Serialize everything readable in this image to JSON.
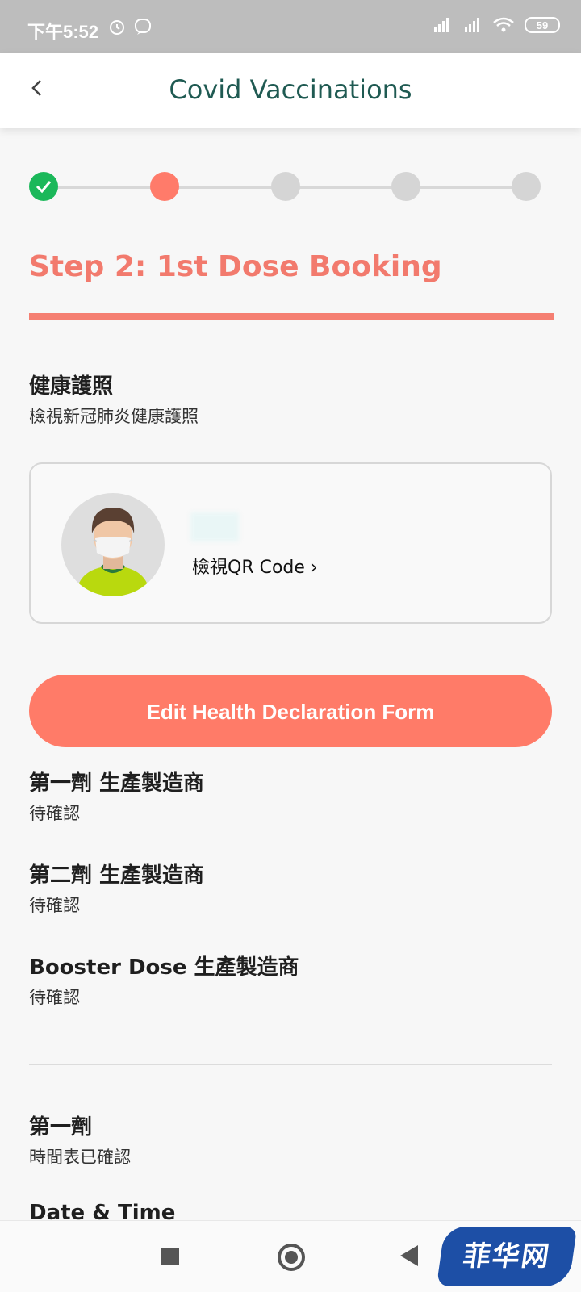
{
  "status_bar": {
    "time": "下午5:52",
    "battery": "59",
    "icons": [
      "alarm-icon",
      "viber-icon",
      "signal-r-icon",
      "signal-icon",
      "wifi-icon",
      "battery-icon"
    ]
  },
  "header": {
    "title": "Covid Vaccinations",
    "back_icon": "chevron-left-icon"
  },
  "stepper": {
    "steps": [
      {
        "state": "done"
      },
      {
        "state": "current"
      },
      {
        "state": "pending"
      },
      {
        "state": "pending"
      },
      {
        "state": "pending"
      }
    ]
  },
  "step_title": "Step 2: 1st Dose Booking",
  "health_passport": {
    "title": "健康護照",
    "subtitle": "檢視新冠肺炎健康護照",
    "qr_link": "檢視QR Code ›"
  },
  "edit_button": "Edit Health Declaration Form",
  "manufacturers": [
    {
      "title": "第一劑 生產製造商",
      "value": "待確認"
    },
    {
      "title": "第二劑 生產製造商",
      "value": "待確認"
    },
    {
      "title": "Booster Dose 生產製造商",
      "value": "待確認"
    }
  ],
  "first_dose": {
    "title": "第一劑",
    "subtitle": "時間表已確認",
    "date_time_label": "Date & Time"
  },
  "watermark": "菲华网",
  "colors": {
    "accent": "#ff7b68",
    "title_teal": "#1f5a52",
    "done_green": "#1bb85a",
    "pending_gray": "#d5d5d5"
  }
}
